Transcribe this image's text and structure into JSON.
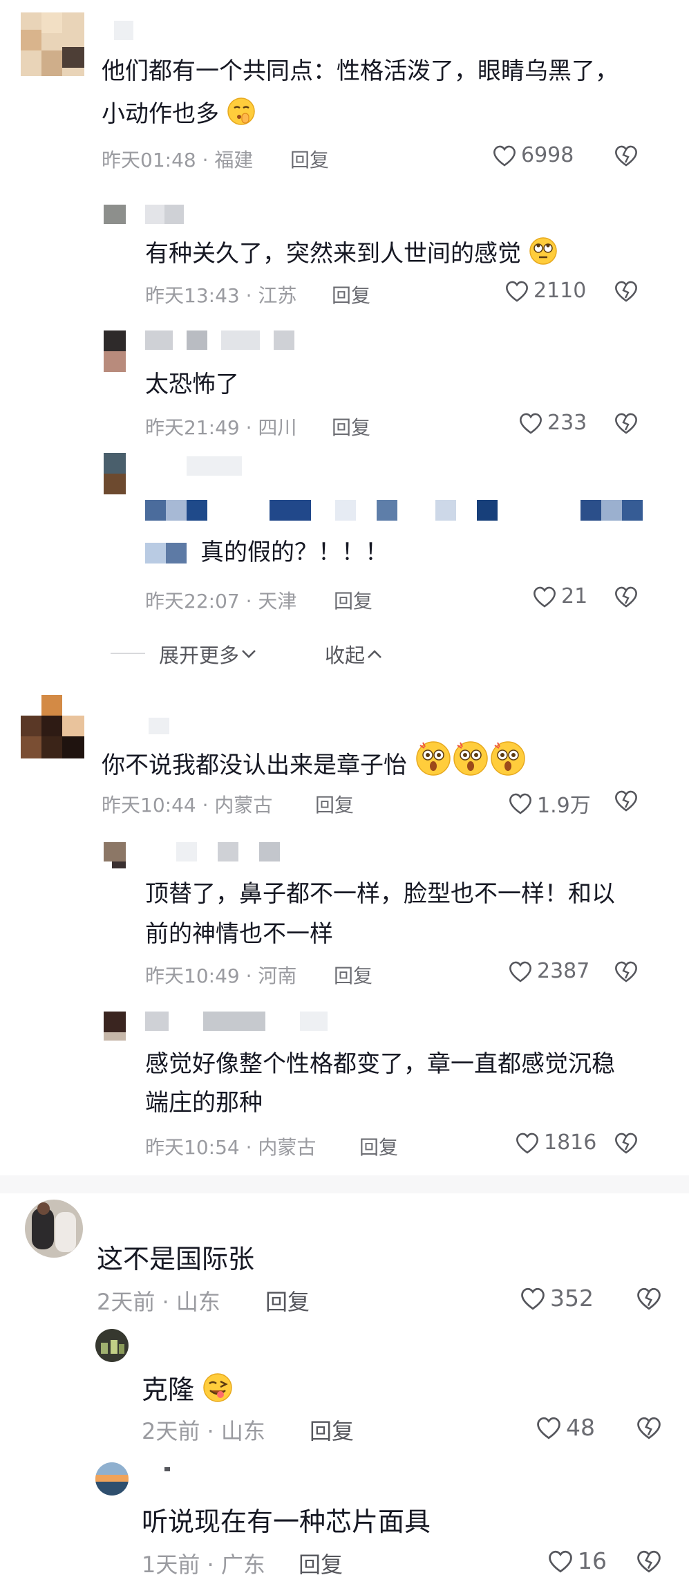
{
  "comments": [
    {
      "text": "他们都有一个共同点：性格活泼了，眼睛乌黑了，",
      "text2": "小动作也多",
      "time": "昨天01:48 · 福建",
      "reply": "回复",
      "likes": "6998",
      "emoji": "shush-face-icon"
    },
    {
      "text": "有种关久了，突然来到人世间的感觉",
      "time": "昨天13:43 · 江苏",
      "reply": "回复",
      "likes": "2110",
      "emoji": "rolling-eyes-face-icon"
    },
    {
      "text": "太恐怖了",
      "time": "昨天21:49 · 四川",
      "reply": "回复",
      "likes": "233"
    },
    {
      "text": "真的假的？！！！",
      "time": "昨天22:07 · 天津",
      "reply": "回复",
      "likes": "21"
    },
    {
      "text": "你不说我都没认出来是章子怡",
      "time": "昨天10:44 · 内蒙古",
      "reply": "回复",
      "likes": "1.9万",
      "emoji": "shocked-face-icon"
    },
    {
      "text": "顶替了，鼻子都不一样，脸型也不一样！和以",
      "text2": "前的神情也不一样",
      "time": "昨天10:49 · 河南",
      "reply": "回复",
      "likes": "2387"
    },
    {
      "text": "感觉好像整个性格都变了，章一直都感觉沉稳",
      "text2": "端庄的那种",
      "time": "昨天10:54 · 内蒙古",
      "reply": "回复",
      "likes": "1816"
    },
    {
      "text": "这不是国际张",
      "time": "2天前 · 山东",
      "reply": "回复",
      "likes": "352"
    },
    {
      "text": "克隆",
      "time": "2天前 · 山东",
      "reply": "回复",
      "likes": "48",
      "emoji": "winking-tongue-face-icon"
    },
    {
      "text": "听说现在有一种芯片面具",
      "time": "1天前 · 广东",
      "reply": "回复",
      "likes": "16"
    }
  ],
  "expand": {
    "more_label": "展开更多",
    "collapse_label": "收起"
  },
  "colors": {
    "text": "#161823",
    "meta": "#9a9ba0",
    "reply": "#6b6c72",
    "heart": "#55565c"
  }
}
